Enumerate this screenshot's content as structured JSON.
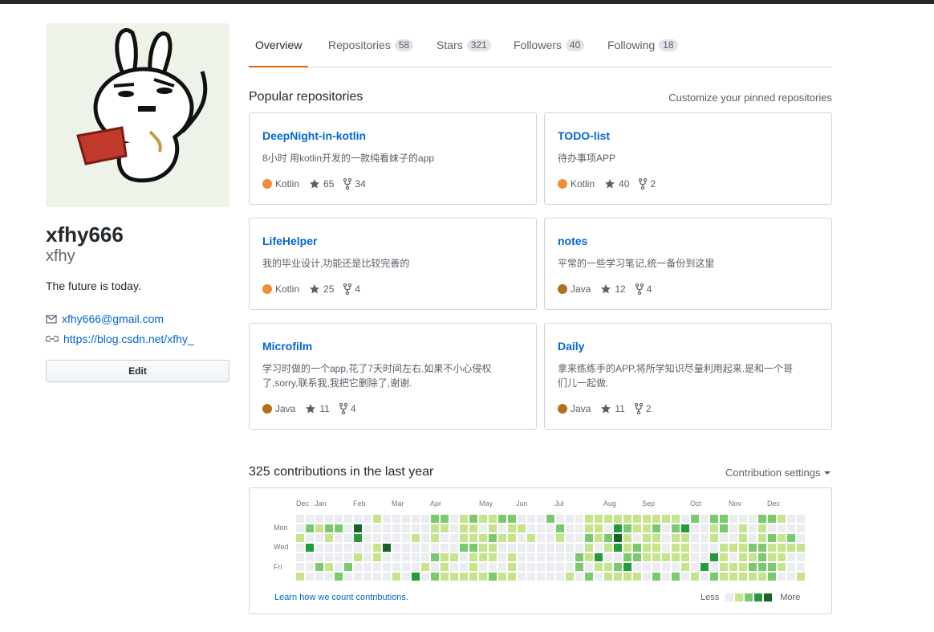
{
  "profile": {
    "fullname": "xfhy666",
    "username": "xfhy",
    "bio": "The future is today.",
    "email": "xfhy666@gmail.com",
    "website": "https://blog.csdn.net/xfhy_",
    "edit_label": "Edit"
  },
  "tabs": [
    {
      "label": "Overview",
      "count": ""
    },
    {
      "label": "Repositories",
      "count": "58"
    },
    {
      "label": "Stars",
      "count": "321"
    },
    {
      "label": "Followers",
      "count": "40"
    },
    {
      "label": "Following",
      "count": "18"
    }
  ],
  "popular": {
    "title": "Popular repositories",
    "customize": "Customize your pinned repositories",
    "repos": [
      {
        "name": "DeepNight-in-kotlin",
        "desc": "8小时 用kotlin开发的一款纯看妹子的app",
        "lang": "Kotlin",
        "lang_color": "#F18E33",
        "stars": "65",
        "forks": "34"
      },
      {
        "name": "TODO-list",
        "desc": "待办事项APP",
        "lang": "Kotlin",
        "lang_color": "#F18E33",
        "stars": "40",
        "forks": "2"
      },
      {
        "name": "LifeHelper",
        "desc": "我的毕业设计,功能还是比较完善的",
        "lang": "Kotlin",
        "lang_color": "#F18E33",
        "stars": "25",
        "forks": "4"
      },
      {
        "name": "notes",
        "desc": "平常的一些学习笔记,统一备份到这里",
        "lang": "Java",
        "lang_color": "#B07219",
        "stars": "12",
        "forks": "4"
      },
      {
        "name": "Microfilm",
        "desc": "学习时做的一个app,花了7天时间左右.如果不小心侵权了,sorry,联系我,我把它删除了,谢谢.",
        "lang": "Java",
        "lang_color": "#B07219",
        "stars": "11",
        "forks": "4"
      },
      {
        "name": "Daily",
        "desc": "拿来练练手的APP,将所学知识尽量利用起来.是和一个哥们儿一起做.",
        "lang": "Java",
        "lang_color": "#B07219",
        "stars": "11",
        "forks": "2"
      }
    ]
  },
  "contributions": {
    "title": "325 contributions in the last year",
    "settings_label": "Contribution settings",
    "months": [
      "Dec",
      "Jan",
      "Feb",
      "Mar",
      "Apr",
      "May",
      "Jun",
      "Jul",
      "Aug",
      "Sep",
      "Oct",
      "Nov",
      "Dec"
    ],
    "weekdays": [
      "Mon",
      "Wed",
      "Fri"
    ],
    "learn_link": "Learn how we count contributions.",
    "legend_less": "Less",
    "legend_more": "More",
    "level_colors": [
      "#ebedf0",
      "#c6e48b",
      "#7bc96f",
      "#239a3b",
      "#196127"
    ]
  }
}
